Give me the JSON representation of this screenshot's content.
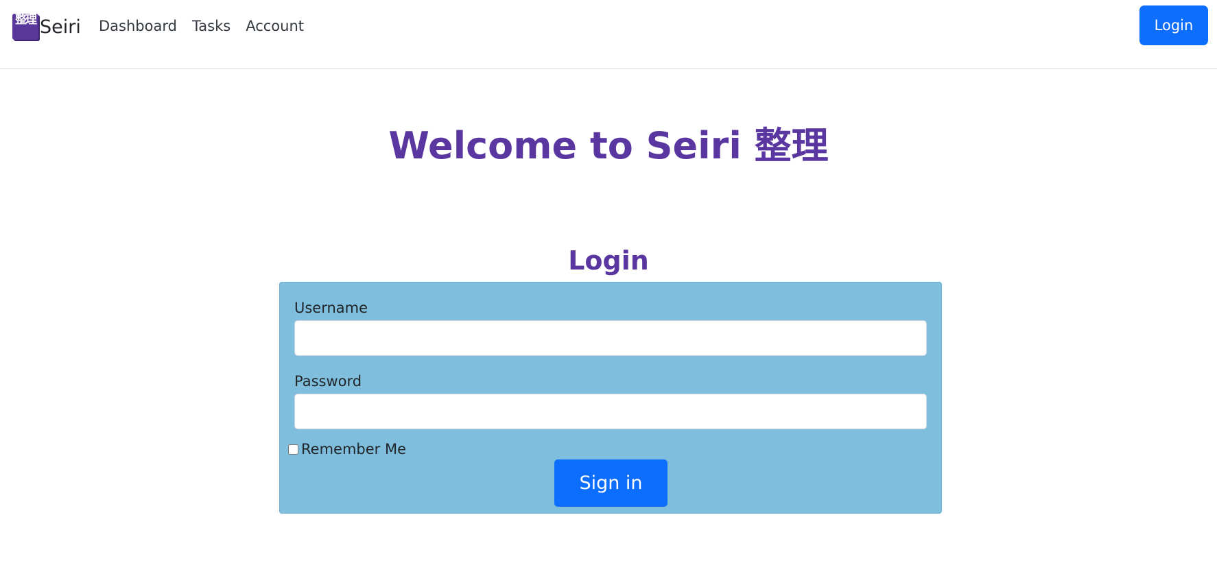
{
  "brand": {
    "logo_text": "整理",
    "name": "Seiri"
  },
  "nav": {
    "links": [
      "Dashboard",
      "Tasks",
      "Account"
    ],
    "login_button": "Login"
  },
  "hero": {
    "title": "Welcome to Seiri 整理"
  },
  "login_form": {
    "heading": "Login",
    "username_label": "Username",
    "username_value": "",
    "password_label": "Password",
    "password_value": "",
    "remember_label": "Remember Me",
    "remember_checked": false,
    "submit_label": "Sign in"
  },
  "colors": {
    "brand_purple": "#5a36a0",
    "primary_button": "#0d6efd",
    "card_background": "#7fbfdd"
  }
}
